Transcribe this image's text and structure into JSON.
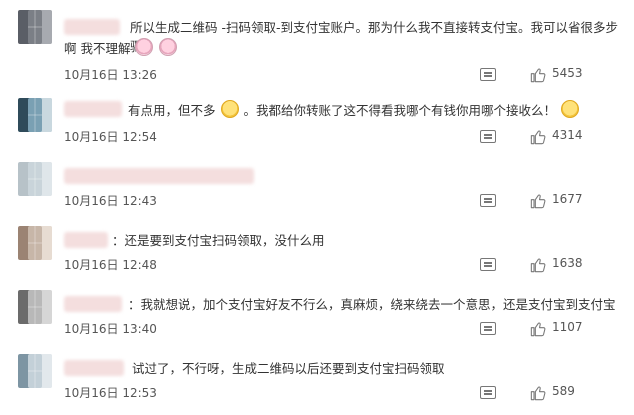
{
  "comments": [
    {
      "text": "所以生成二维码 -扫码领取-到支付宝账户。那为什么我不直接转支付宝。我可以省很多步骤",
      "text2": "啊 我不理解",
      "emojis": [
        "pig-face-emoji",
        "pig-face-emoji"
      ],
      "time": "10月16日 13:26",
      "likes": "5453"
    },
    {
      "text": "有点用，但不多",
      "text_after_emoji": "。我都给你转账了这不得看我哪个有钱你用哪个接收么！",
      "emojis": [
        "yum-face-emoji",
        "yum-face-emoji"
      ],
      "time": "10月16日 12:54",
      "likes": "4314"
    },
    {
      "text": "",
      "time": "10月16日 12:43",
      "likes": "1677"
    },
    {
      "text": "：还是要到支付宝扫码领取，没什么用",
      "time": "10月16日 12:48",
      "likes": "1638"
    },
    {
      "text": "：我就想说，加个支付宝好友不行么，真麻烦，绕来绕去一个意思，还是支付宝到支付宝",
      "time": "10月16日 13:40",
      "likes": "1107"
    },
    {
      "text": "试过了，不行呀，生成二维码以后还要到支付宝扫码领取",
      "time": "10月16日 12:53",
      "likes": "589"
    }
  ],
  "icons": {
    "reply": "reply-icon",
    "like": "thumbs-up-icon"
  }
}
